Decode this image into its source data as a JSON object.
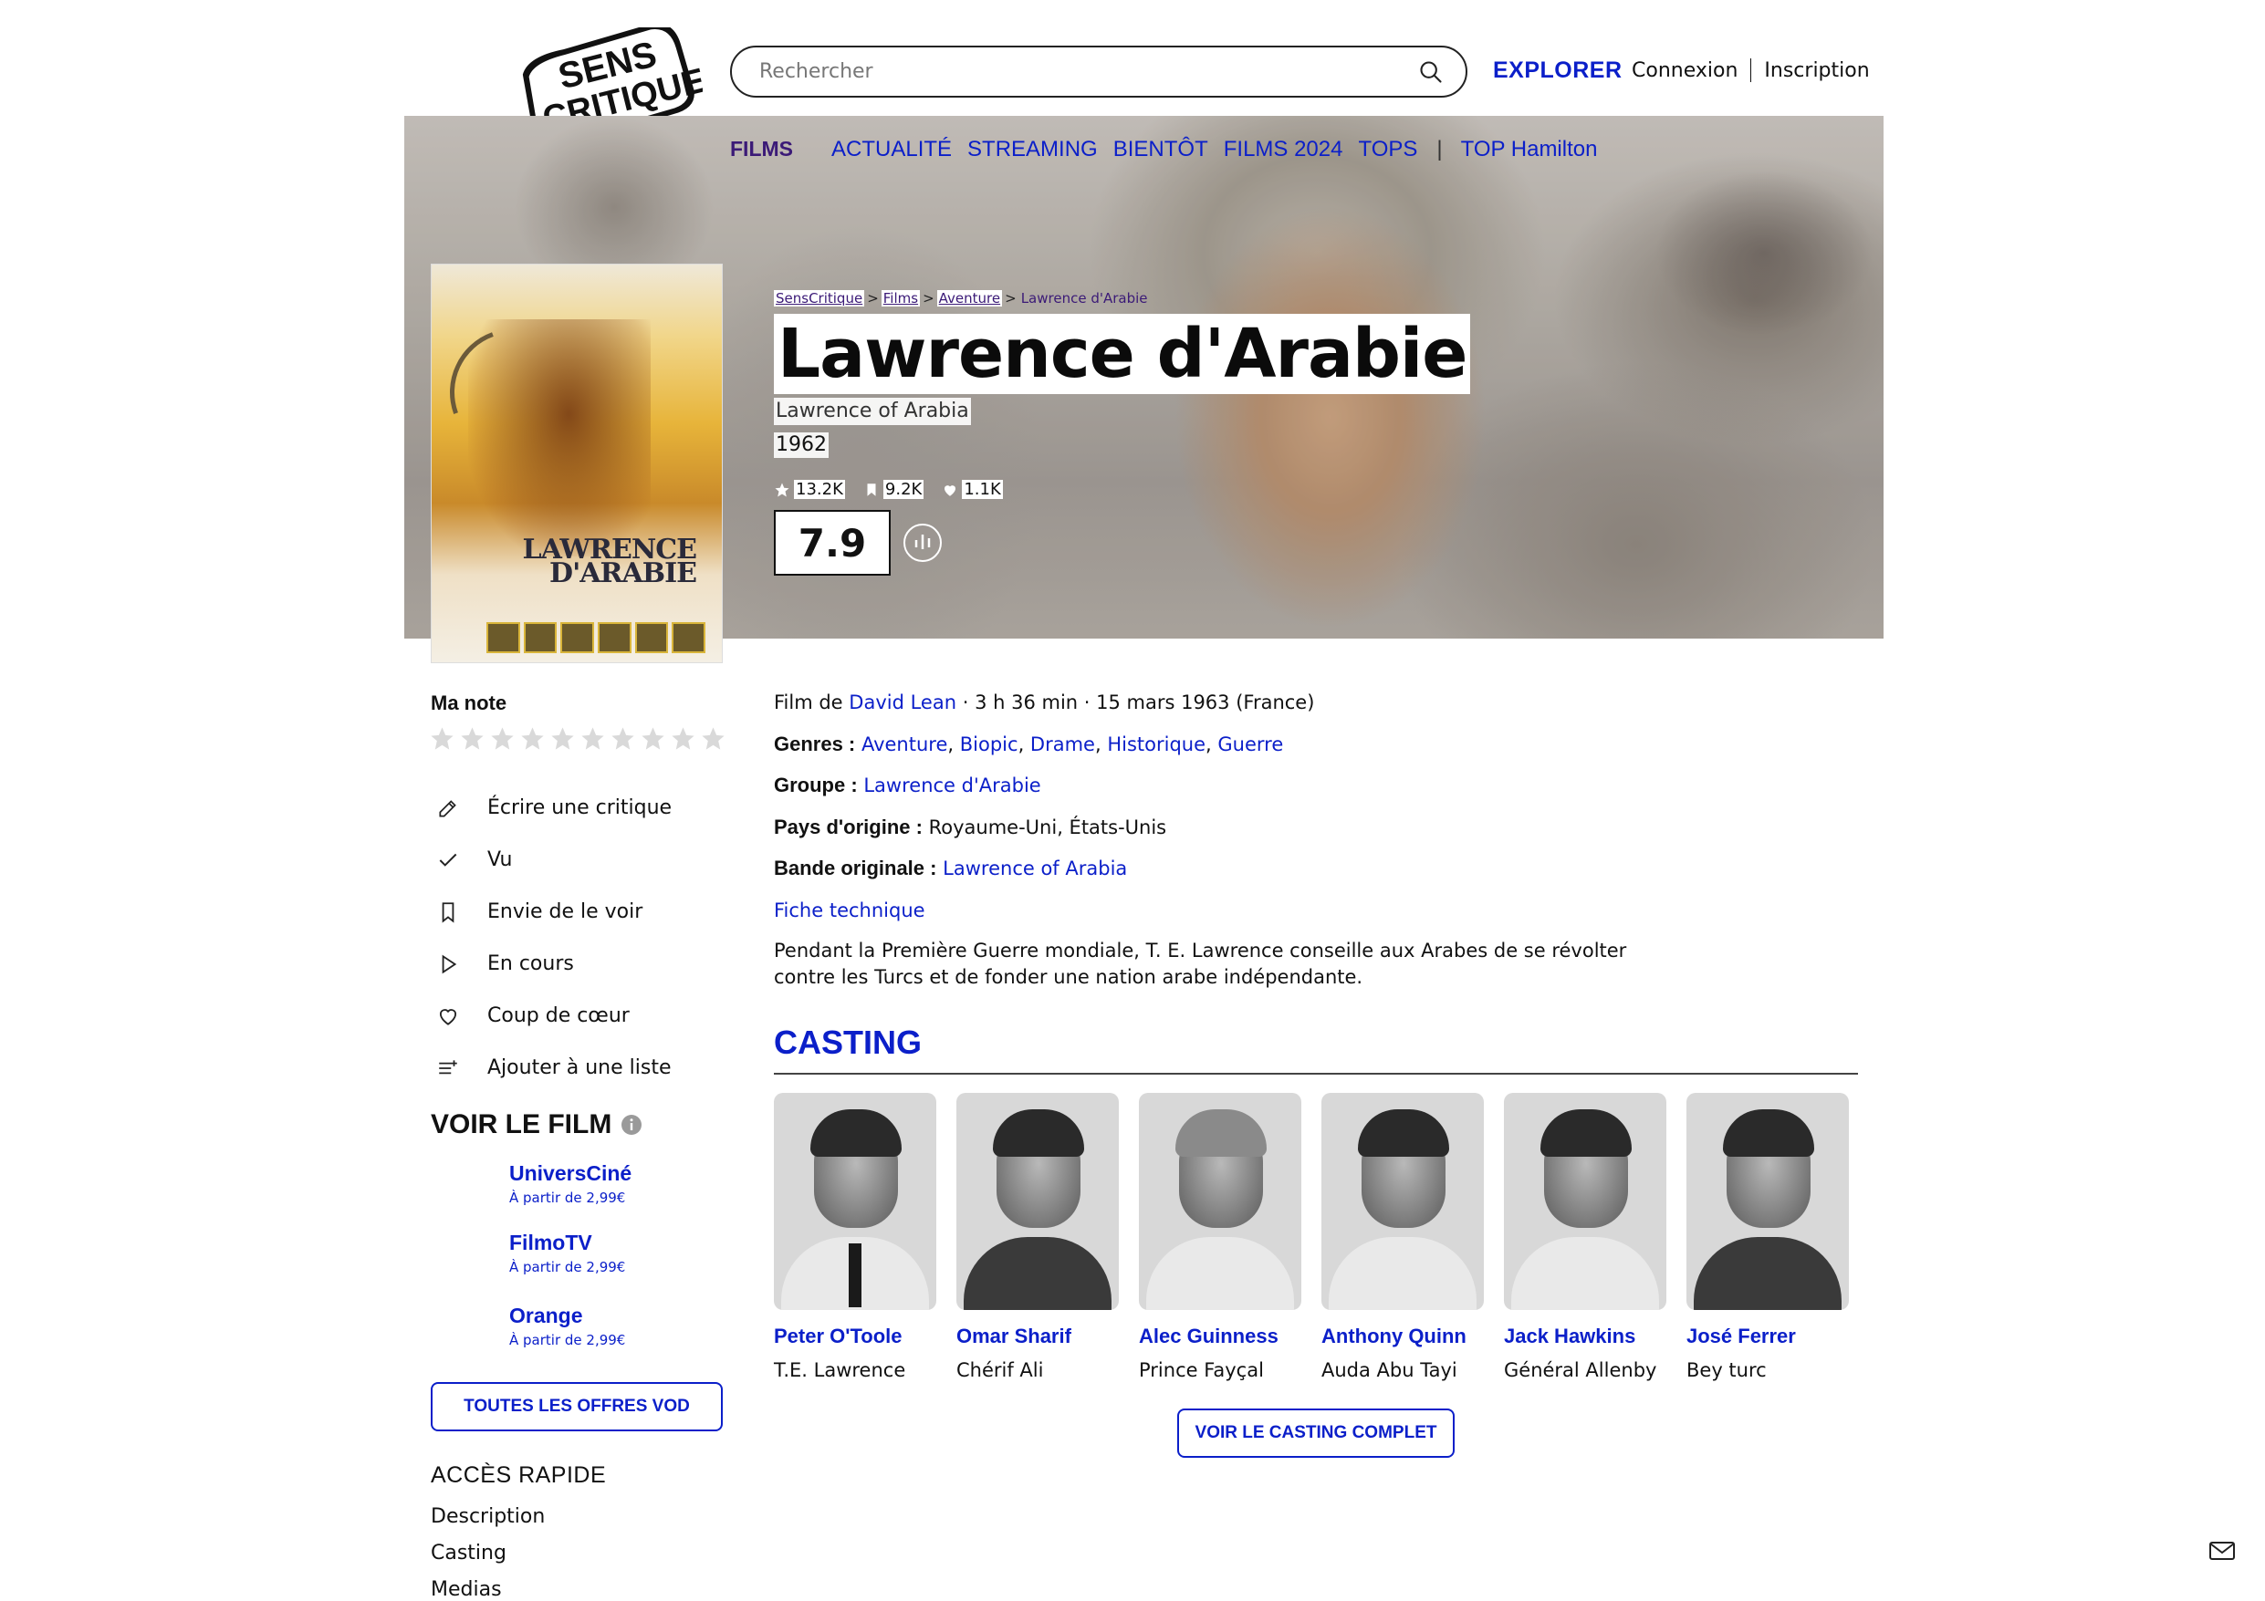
{
  "header": {
    "logo_text_line1": "SENS",
    "logo_text_line2": "CRITIQUE",
    "search_placeholder": "Rechercher",
    "explore_label": "EXPLORER",
    "login_label": "Connexion",
    "signup_label": "Inscription"
  },
  "nav": {
    "films_label": "FILMS",
    "items": [
      "ACTUALITÉ",
      "STREAMING",
      "BIENTÔT",
      "FILMS 2024",
      "TOPS"
    ],
    "top_label": "TOP Hamilton"
  },
  "breadcrumb": [
    "SensCritique",
    "Films",
    "Aventure",
    "Lawrence d'Arabie"
  ],
  "film": {
    "title": "Lawrence d'Arabie",
    "original_title": "Lawrence of Arabia",
    "year": "1962",
    "ratings_count": "13.2K",
    "wishlist_count": "9.2K",
    "favorites_count": "1.1K",
    "score": "7.9",
    "poster_title": "LAWRENCE D'ARABIE"
  },
  "my_rating": {
    "label": "Ma note",
    "stars_max": 10
  },
  "actions": [
    {
      "label": "Écrire une critique",
      "icon": "pencil-icon"
    },
    {
      "label": "Vu",
      "icon": "check-icon"
    },
    {
      "label": "Envie de le voir",
      "icon": "bookmark-icon"
    },
    {
      "label": "En cours",
      "icon": "play-icon"
    },
    {
      "label": "Coup de cœur",
      "icon": "heart-icon"
    },
    {
      "label": "Ajouter à une liste",
      "icon": "add-list-icon"
    }
  ],
  "watch": {
    "title": "VOIR LE FILM",
    "offers": [
      {
        "name": "UniversCiné",
        "price": "À partir de 2,99€"
      },
      {
        "name": "FilmoTV",
        "price": "À partir de 2,99€"
      },
      {
        "name": "Orange",
        "price": "À partir de 2,99€"
      }
    ],
    "all_offers_label": "TOUTES LES OFFRES VOD"
  },
  "quick_access": {
    "title": "ACCÈS RAPIDE",
    "items": [
      "Description",
      "Casting",
      "Medias"
    ]
  },
  "details": {
    "film_by_prefix": "Film de",
    "director": "David Lean",
    "meta": " · 3 h 36 min · 15 mars 1963 (France)",
    "genres_label": "Genres :",
    "genres": [
      "Aventure",
      "Biopic",
      "Drame",
      "Historique",
      "Guerre"
    ],
    "group_label": "Groupe :",
    "group": "Lawrence d'Arabie",
    "country_label": "Pays d'origine :",
    "country": "Royaume-Uni, États-Unis",
    "original_label": "Bande originale :",
    "original": "Lawrence of Arabia",
    "tech_sheet": "Fiche technique",
    "synopsis_line1": "Pendant la Première Guerre mondiale, T. E. Lawrence conseille aux Arabes de se révolter",
    "synopsis_line2": "contre les Turcs et de fonder une nation arabe indépendante."
  },
  "casting": {
    "title": "CASTING",
    "members": [
      {
        "name": "Peter O'Toole",
        "role": "T.E. Lawrence"
      },
      {
        "name": "Omar Sharif",
        "role": "Chérif Ali"
      },
      {
        "name": "Alec Guinness",
        "role": "Prince Fayçal"
      },
      {
        "name": "Anthony Quinn",
        "role": "Auda Abu Tayi"
      },
      {
        "name": "Jack Hawkins",
        "role": "Général Allenby"
      },
      {
        "name": "José Ferrer",
        "role": "Bey turc"
      }
    ],
    "full_cast_label": "VOIR LE CASTING COMPLET"
  },
  "colors": {
    "accent": "#0b1fc9",
    "films_nav": "#3b1a77"
  }
}
